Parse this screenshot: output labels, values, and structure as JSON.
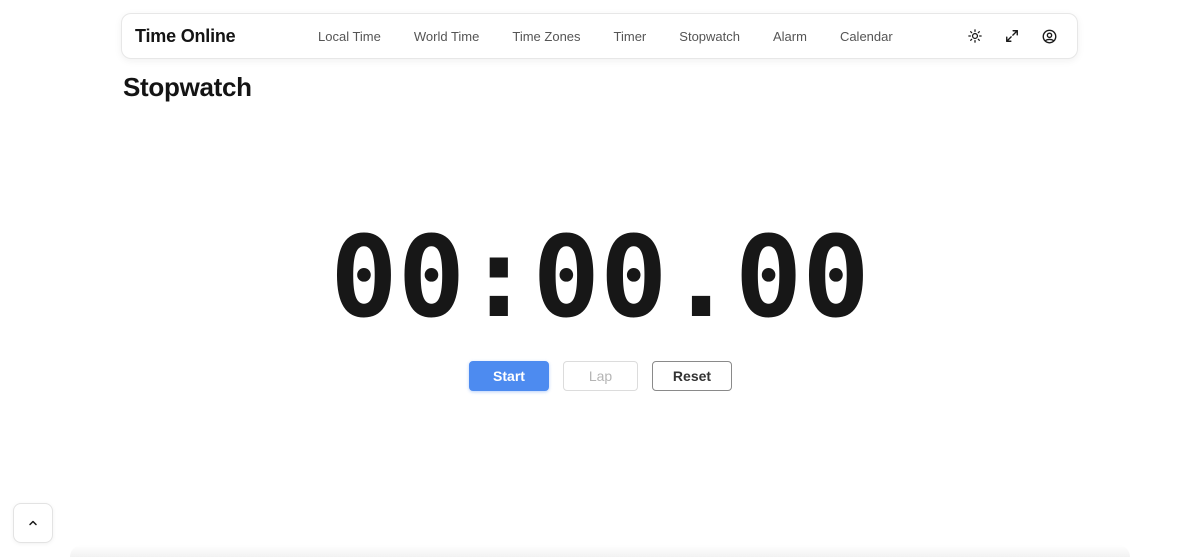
{
  "brand": "Time Online",
  "nav": {
    "items": [
      {
        "label": "Local Time"
      },
      {
        "label": "World Time"
      },
      {
        "label": "Time Zones"
      },
      {
        "label": "Timer"
      },
      {
        "label": "Stopwatch"
      },
      {
        "label": "Alarm"
      },
      {
        "label": "Calendar"
      }
    ],
    "icons": [
      "sun-icon",
      "expand-icon",
      "user-circle-icon"
    ]
  },
  "page": {
    "title": "Stopwatch"
  },
  "stopwatch": {
    "display": "00:00.00",
    "start_label": "Start",
    "lap_label": "Lap",
    "reset_label": "Reset"
  },
  "scroll_top": {
    "icon": "chevron-up-icon"
  },
  "colors": {
    "accent": "#4d8bf0",
    "text": "#141414",
    "muted": "#555555",
    "disabled": "#b5b5b5"
  }
}
